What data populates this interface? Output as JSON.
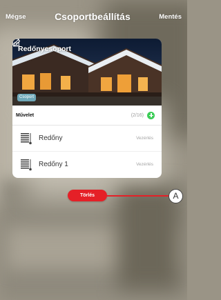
{
  "header": {
    "cancel_label": "Mégse",
    "title": "Csoportbeállítás",
    "save_label": "Mentés"
  },
  "group": {
    "name": "Redőnycsoport",
    "tag": "Csoport",
    "edit_icon": "pencil-icon",
    "image_icon": "image-icon"
  },
  "operations": {
    "label": "Művelet",
    "count": "(2/16)",
    "add_icon": "plus-circle-icon"
  },
  "devices": [
    {
      "name": "Redőny",
      "action": "Vezérlés",
      "icon": "shutter-icon"
    },
    {
      "name": "Redőny 1",
      "action": "Vezérlés",
      "icon": "shutter-icon"
    }
  ],
  "delete_label": "Törlés",
  "callout_label": "A",
  "colors": {
    "accent_green": "#3dcd58",
    "delete_red": "#e52027",
    "tag_blue": "#6fa8b8"
  }
}
